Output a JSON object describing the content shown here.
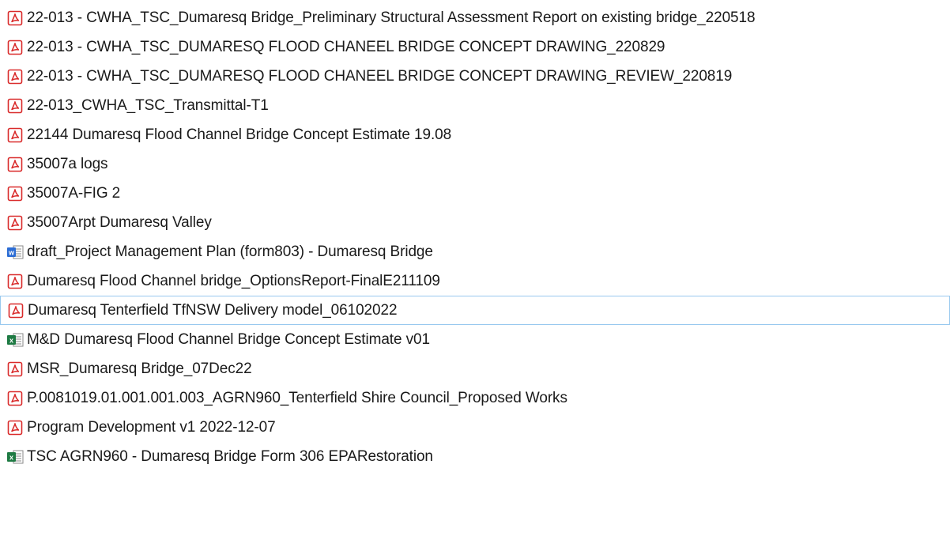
{
  "files": [
    {
      "name": "22-013 - CWHA_TSC_Dumaresq Bridge_Preliminary Structural Assessment Report on existing bridge_220518",
      "icon": "pdf-icon",
      "hover": false
    },
    {
      "name": "22-013 - CWHA_TSC_DUMARESQ FLOOD CHANEEL BRIDGE CONCEPT DRAWING_220829",
      "icon": "pdf-icon",
      "hover": false
    },
    {
      "name": "22-013 - CWHA_TSC_DUMARESQ FLOOD CHANEEL BRIDGE CONCEPT DRAWING_REVIEW_220819",
      "icon": "pdf-icon",
      "hover": false
    },
    {
      "name": "22-013_CWHA_TSC_Transmittal-T1",
      "icon": "pdf-icon",
      "hover": false
    },
    {
      "name": "22144 Dumaresq Flood Channel Bridge Concept Estimate 19.08",
      "icon": "pdf-icon",
      "hover": false
    },
    {
      "name": "35007a logs",
      "icon": "pdf-icon",
      "hover": false
    },
    {
      "name": "35007A-FIG 2",
      "icon": "pdf-icon",
      "hover": false
    },
    {
      "name": "35007Arpt Dumaresq Valley",
      "icon": "pdf-icon",
      "hover": false
    },
    {
      "name": "draft_Project Management Plan (form803) - Dumaresq Bridge",
      "icon": "word-doc-icon",
      "hover": false
    },
    {
      "name": "Dumaresq Flood Channel bridge_OptionsReport-FinalE211109",
      "icon": "pdf-icon",
      "hover": false
    },
    {
      "name": "Dumaresq Tenterfield TfNSW Delivery model_06102022",
      "icon": "pdf-icon",
      "hover": true
    },
    {
      "name": "M&D Dumaresq Flood Channel Bridge Concept Estimate v01",
      "icon": "excel-icon",
      "hover": false
    },
    {
      "name": "MSR_Dumaresq Bridge_07Dec22",
      "icon": "pdf-icon",
      "hover": false
    },
    {
      "name": "P.0081019.01.001.001.003_AGRN960_Tenterfield Shire Council_Proposed Works",
      "icon": "pdf-icon",
      "hover": false
    },
    {
      "name": "Program Development v1 2022-12-07",
      "icon": "pdf-icon",
      "hover": false
    },
    {
      "name": "TSC AGRN960 - Dumaresq Bridge Form 306 EPARestoration",
      "icon": "excel-icon",
      "hover": false
    }
  ],
  "colors": {
    "pdf": "#d92b2b",
    "word": "#2b6cd4",
    "excel": "#1e7a43",
    "hover_border": "#99c9ef"
  }
}
